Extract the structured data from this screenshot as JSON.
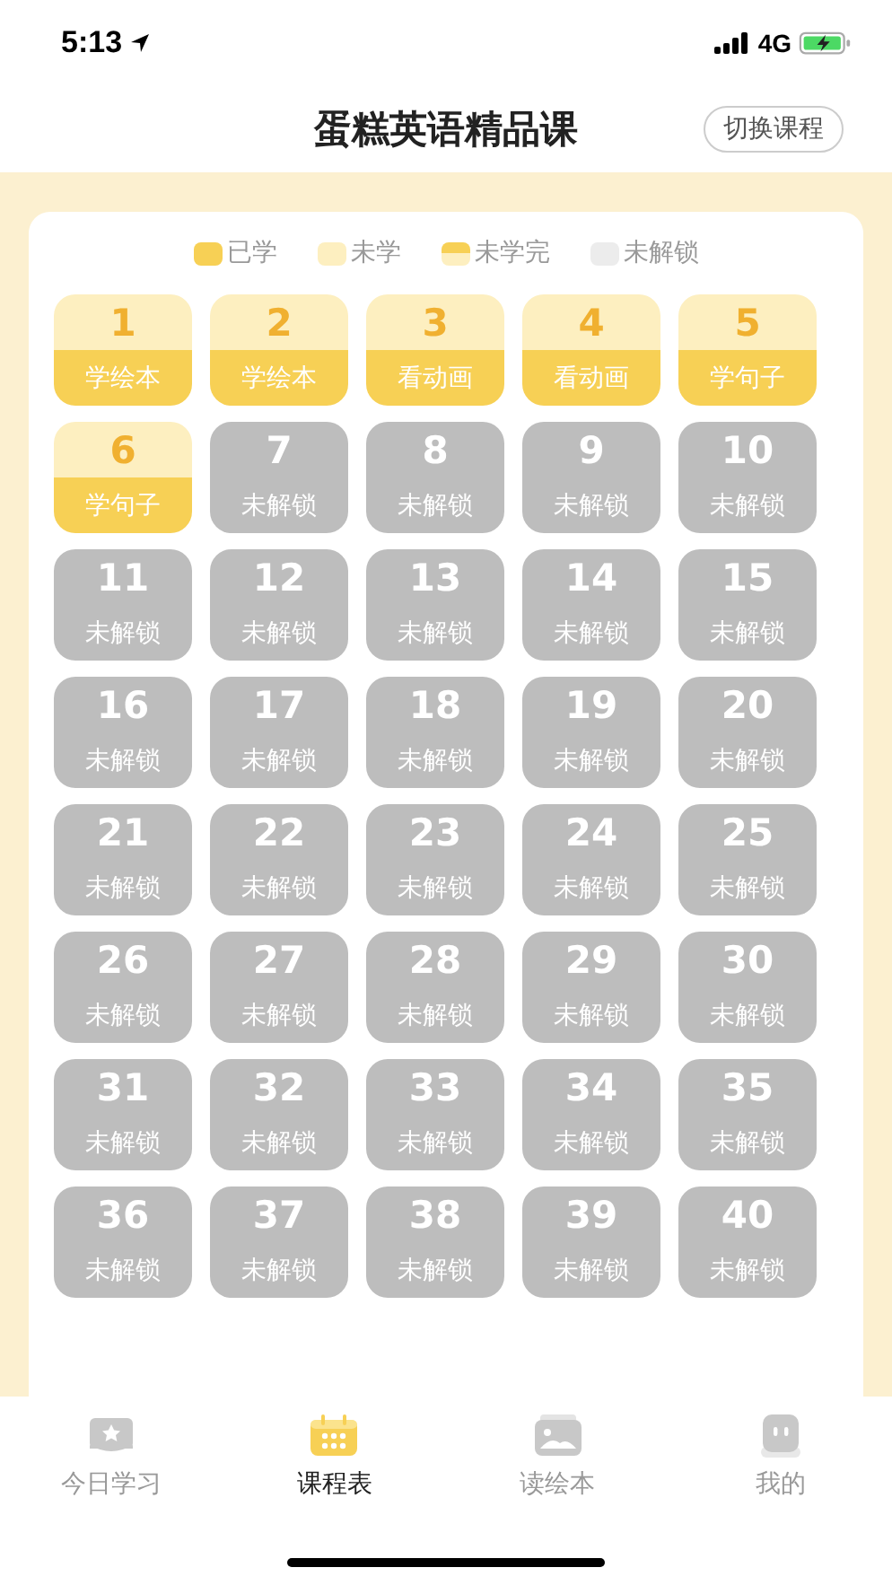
{
  "status_bar": {
    "time": "5:13",
    "network": "4G"
  },
  "header": {
    "title": "蛋糕英语精品课",
    "switch_button": "切换课程"
  },
  "legend": [
    {
      "kind": "learned",
      "label": "已学"
    },
    {
      "kind": "unlearned",
      "label": "未学"
    },
    {
      "kind": "partial",
      "label": "未学完"
    },
    {
      "kind": "locked",
      "label": "未解锁"
    }
  ],
  "lessons": [
    {
      "number": "1",
      "label": "学绘本",
      "kind": "learned"
    },
    {
      "number": "2",
      "label": "学绘本",
      "kind": "learned"
    },
    {
      "number": "3",
      "label": "看动画",
      "kind": "learned"
    },
    {
      "number": "4",
      "label": "看动画",
      "kind": "learned"
    },
    {
      "number": "5",
      "label": "学句子",
      "kind": "learned"
    },
    {
      "number": "6",
      "label": "学句子",
      "kind": "learned"
    },
    {
      "number": "7",
      "label": "未解锁",
      "kind": "locked"
    },
    {
      "number": "8",
      "label": "未解锁",
      "kind": "locked"
    },
    {
      "number": "9",
      "label": "未解锁",
      "kind": "locked"
    },
    {
      "number": "10",
      "label": "未解锁",
      "kind": "locked"
    },
    {
      "number": "11",
      "label": "未解锁",
      "kind": "locked"
    },
    {
      "number": "12",
      "label": "未解锁",
      "kind": "locked"
    },
    {
      "number": "13",
      "label": "未解锁",
      "kind": "locked"
    },
    {
      "number": "14",
      "label": "未解锁",
      "kind": "locked"
    },
    {
      "number": "15",
      "label": "未解锁",
      "kind": "locked"
    },
    {
      "number": "16",
      "label": "未解锁",
      "kind": "locked"
    },
    {
      "number": "17",
      "label": "未解锁",
      "kind": "locked"
    },
    {
      "number": "18",
      "label": "未解锁",
      "kind": "locked"
    },
    {
      "number": "19",
      "label": "未解锁",
      "kind": "locked"
    },
    {
      "number": "20",
      "label": "未解锁",
      "kind": "locked"
    },
    {
      "number": "21",
      "label": "未解锁",
      "kind": "locked"
    },
    {
      "number": "22",
      "label": "未解锁",
      "kind": "locked"
    },
    {
      "number": "23",
      "label": "未解锁",
      "kind": "locked"
    },
    {
      "number": "24",
      "label": "未解锁",
      "kind": "locked"
    },
    {
      "number": "25",
      "label": "未解锁",
      "kind": "locked"
    },
    {
      "number": "26",
      "label": "未解锁",
      "kind": "locked"
    },
    {
      "number": "27",
      "label": "未解锁",
      "kind": "locked"
    },
    {
      "number": "28",
      "label": "未解锁",
      "kind": "locked"
    },
    {
      "number": "29",
      "label": "未解锁",
      "kind": "locked"
    },
    {
      "number": "30",
      "label": "未解锁",
      "kind": "locked"
    },
    {
      "number": "31",
      "label": "未解锁",
      "kind": "locked"
    },
    {
      "number": "32",
      "label": "未解锁",
      "kind": "locked"
    },
    {
      "number": "33",
      "label": "未解锁",
      "kind": "locked"
    },
    {
      "number": "34",
      "label": "未解锁",
      "kind": "locked"
    },
    {
      "number": "35",
      "label": "未解锁",
      "kind": "locked"
    },
    {
      "number": "36",
      "label": "未解锁",
      "kind": "locked"
    },
    {
      "number": "37",
      "label": "未解锁",
      "kind": "locked"
    },
    {
      "number": "38",
      "label": "未解锁",
      "kind": "locked"
    },
    {
      "number": "39",
      "label": "未解锁",
      "kind": "locked"
    },
    {
      "number": "40",
      "label": "未解锁",
      "kind": "locked"
    }
  ],
  "tab_bar": [
    {
      "kind": "today",
      "label": "今日学习",
      "selected": false
    },
    {
      "kind": "schedule",
      "label": "课程表",
      "selected": true
    },
    {
      "kind": "books",
      "label": "读绘本",
      "selected": false
    },
    {
      "kind": "me",
      "label": "我的",
      "selected": false
    }
  ]
}
